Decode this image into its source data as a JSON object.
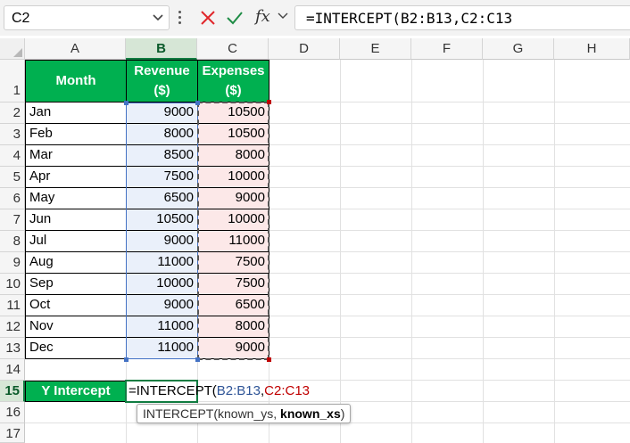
{
  "formula_bar": {
    "name_box": "C2",
    "fx_label": "fx",
    "formula": "=INTERCEPT(B2:B13,C2:C13"
  },
  "columns": [
    "A",
    "B",
    "C",
    "D",
    "E",
    "F",
    "G",
    "H"
  ],
  "rows": [
    "1",
    "2",
    "3",
    "4",
    "5",
    "6",
    "7",
    "8",
    "9",
    "10",
    "11",
    "12",
    "13",
    "14",
    "15",
    "16",
    "17"
  ],
  "table": {
    "headers": [
      "Month",
      "Revenue ($)",
      "Expenses ($)"
    ],
    "header_lines": {
      "revenue": [
        "Revenue",
        "($)"
      ],
      "expenses": [
        "Expenses",
        "($)"
      ]
    },
    "rows": [
      {
        "month": "Jan",
        "revenue": "9000",
        "expenses": "10500"
      },
      {
        "month": "Feb",
        "revenue": "8000",
        "expenses": "10500"
      },
      {
        "month": "Mar",
        "revenue": "8500",
        "expenses": "8000"
      },
      {
        "month": "Apr",
        "revenue": "7500",
        "expenses": "10000"
      },
      {
        "month": "May",
        "revenue": "6500",
        "expenses": "9000"
      },
      {
        "month": "Jun",
        "revenue": "10500",
        "expenses": "10000"
      },
      {
        "month": "Jul",
        "revenue": "9000",
        "expenses": "11000"
      },
      {
        "month": "Aug",
        "revenue": "11000",
        "expenses": "7500"
      },
      {
        "month": "Sep",
        "revenue": "10000",
        "expenses": "7500"
      },
      {
        "month": "Oct",
        "revenue": "9000",
        "expenses": "6500"
      },
      {
        "month": "Nov",
        "revenue": "11000",
        "expenses": "8000"
      },
      {
        "month": "Dec",
        "revenue": "11000",
        "expenses": "9000"
      }
    ]
  },
  "intercept": {
    "label": "Y Intercept",
    "edit_prefix": "=INTERCEPT(",
    "range1": "B2:B13",
    "sep": ",",
    "range2": "C2:C13"
  },
  "tooltip": {
    "fn": "INTERCEPT(known_ys, ",
    "bold_arg": "known_xs",
    "close": ")"
  },
  "colors": {
    "header_green": "#00b050",
    "revenue_fill": "#eaf0fa",
    "expenses_fill": "#fce8e8",
    "range1_color": "#2f5597",
    "range2_color": "#c00000",
    "excel_green": "#107c41"
  }
}
